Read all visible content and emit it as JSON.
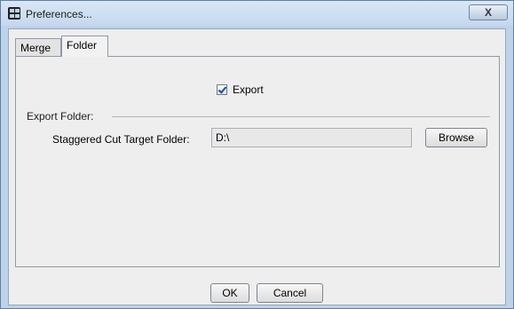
{
  "window": {
    "title": "Preferences...",
    "close_label": "X"
  },
  "tabs": [
    {
      "label": "Merge",
      "active": false
    },
    {
      "label": "Folder",
      "active": true
    }
  ],
  "folder_tab": {
    "export_checkbox": {
      "label": "Export",
      "checked": true
    },
    "group_title": "Export Folder:",
    "target_folder": {
      "label": "Staggered Cut Target Folder:",
      "value": "D:\\"
    },
    "browse_label": "Browse"
  },
  "footer": {
    "ok_label": "OK",
    "cancel_label": "Cancel"
  }
}
